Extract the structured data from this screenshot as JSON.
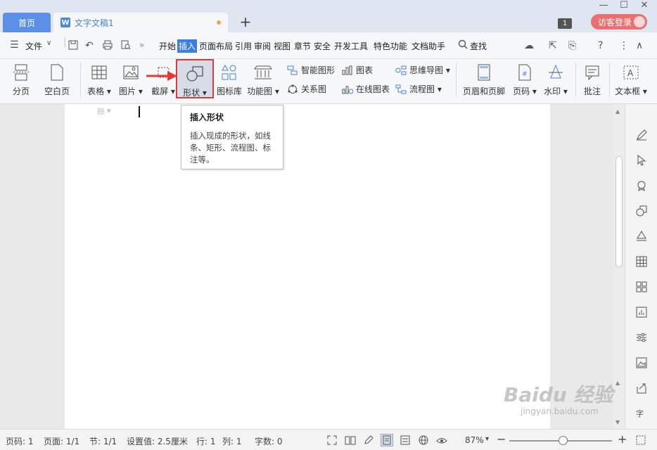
{
  "titlebar": {
    "home_tab": "首页",
    "doc_tab": "文字文稿1",
    "add_tab": "+",
    "badge": "1",
    "login_label": "访客登录",
    "minimize": "—",
    "maximize": "☐",
    "close": "✕"
  },
  "menu": {
    "file": "文件",
    "tabs": [
      "开始",
      "插入",
      "页面布局",
      "引用",
      "审阅",
      "视图",
      "章节",
      "安全",
      "开发工具",
      "特色功能",
      "文档助手"
    ],
    "active_tab": "插入",
    "search": "查找",
    "more": "»"
  },
  "ribbon": {
    "page_break": "分页",
    "blank_page": "空白页",
    "table": "表格",
    "picture": "图片",
    "screenshot": "截屏",
    "shape": "形状",
    "icon_library": "图标库",
    "function_chart": "功能图",
    "smart_shape": "智能图形",
    "chart": "图表",
    "mind_map": "思维导图",
    "relationship": "关系图",
    "online_chart": "在线图表",
    "flowchart": "流程图",
    "header_footer": "页眉和页脚",
    "page_number": "页码",
    "watermark": "水印",
    "comment": "批注",
    "textbox": "文本框"
  },
  "tooltip": {
    "title": "插入形状",
    "description": "插入现成的形状，如线条、矩形、流程图、标注等。"
  },
  "status": {
    "page": "页码: 1",
    "pages": "页面: 1/1",
    "section": "节: 1/1",
    "setting": "设置值: 2.5厘米",
    "row": "行: 1",
    "col": "列: 1",
    "words": "字数: 0",
    "zoom": "87%",
    "zoom_level": 0.52
  },
  "watermark": {
    "brand": "Baidu 经验",
    "url": "jingyan.baidu.com"
  },
  "colors": {
    "accent": "#3c7de0",
    "highlight_border": "#d93a3a",
    "login": "#e97070"
  }
}
